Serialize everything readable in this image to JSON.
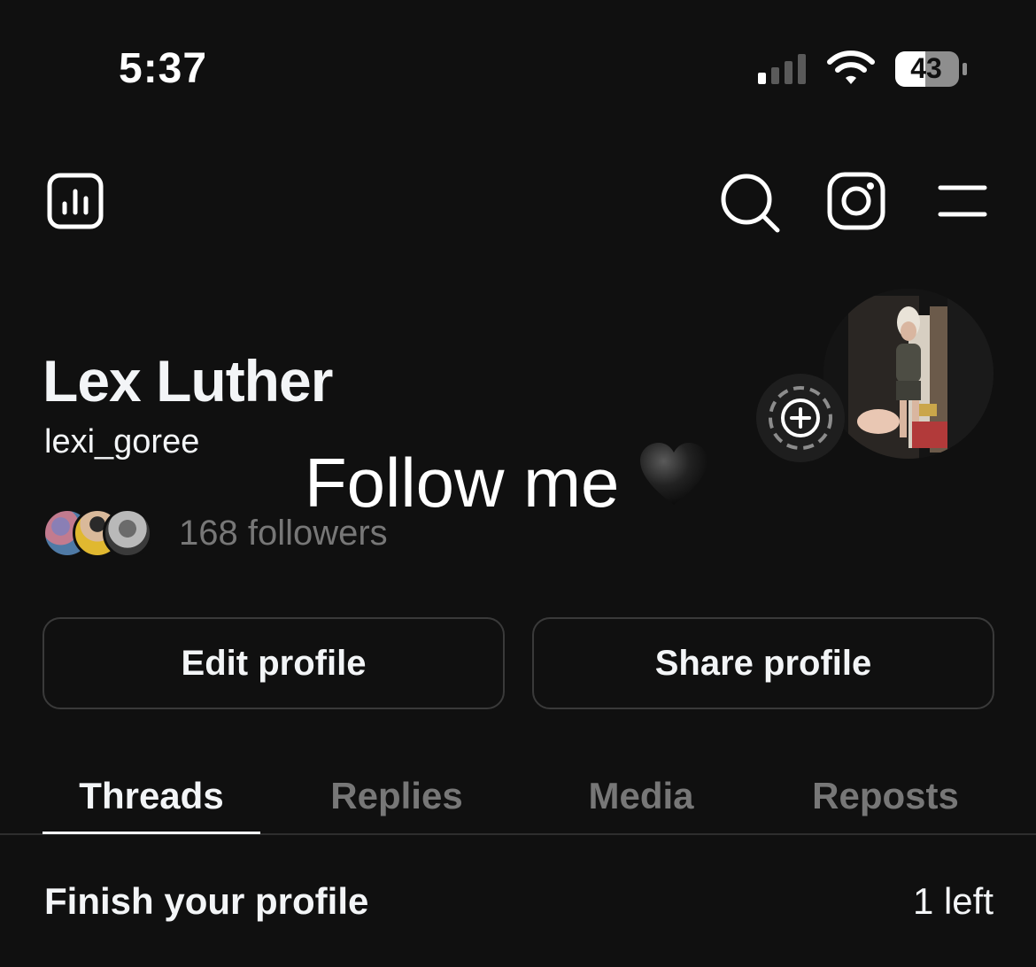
{
  "status_bar": {
    "time": "5:37",
    "battery_level": "43",
    "signal_icon": "cellular-signal-icon",
    "wifi_icon": "wifi-icon",
    "battery_icon": "battery-icon"
  },
  "top_nav": {
    "left_icon": "insights-bar-chart-icon",
    "right_icons": [
      "search-icon",
      "instagram-icon",
      "menu-icon"
    ]
  },
  "profile": {
    "display_name": "Lex Luther",
    "username": "lexi_goree",
    "followers_text": "168 followers",
    "follower_avatar_count": 3,
    "add_story_icon": "plus-icon"
  },
  "overlay": {
    "caption": "Follow me",
    "emoji": "black-heart-icon"
  },
  "actions": {
    "edit_label": "Edit profile",
    "share_label": "Share profile"
  },
  "tabs": [
    {
      "label": "Threads",
      "active": true
    },
    {
      "label": "Replies",
      "active": false
    },
    {
      "label": "Media",
      "active": false
    },
    {
      "label": "Reposts",
      "active": false
    }
  ],
  "finish_profile": {
    "title": "Finish your profile",
    "remaining": "1 left"
  },
  "colors": {
    "background": "#101010",
    "primary_text": "#f3f5f7",
    "secondary_text": "#777777",
    "border": "#3a3a3a"
  }
}
